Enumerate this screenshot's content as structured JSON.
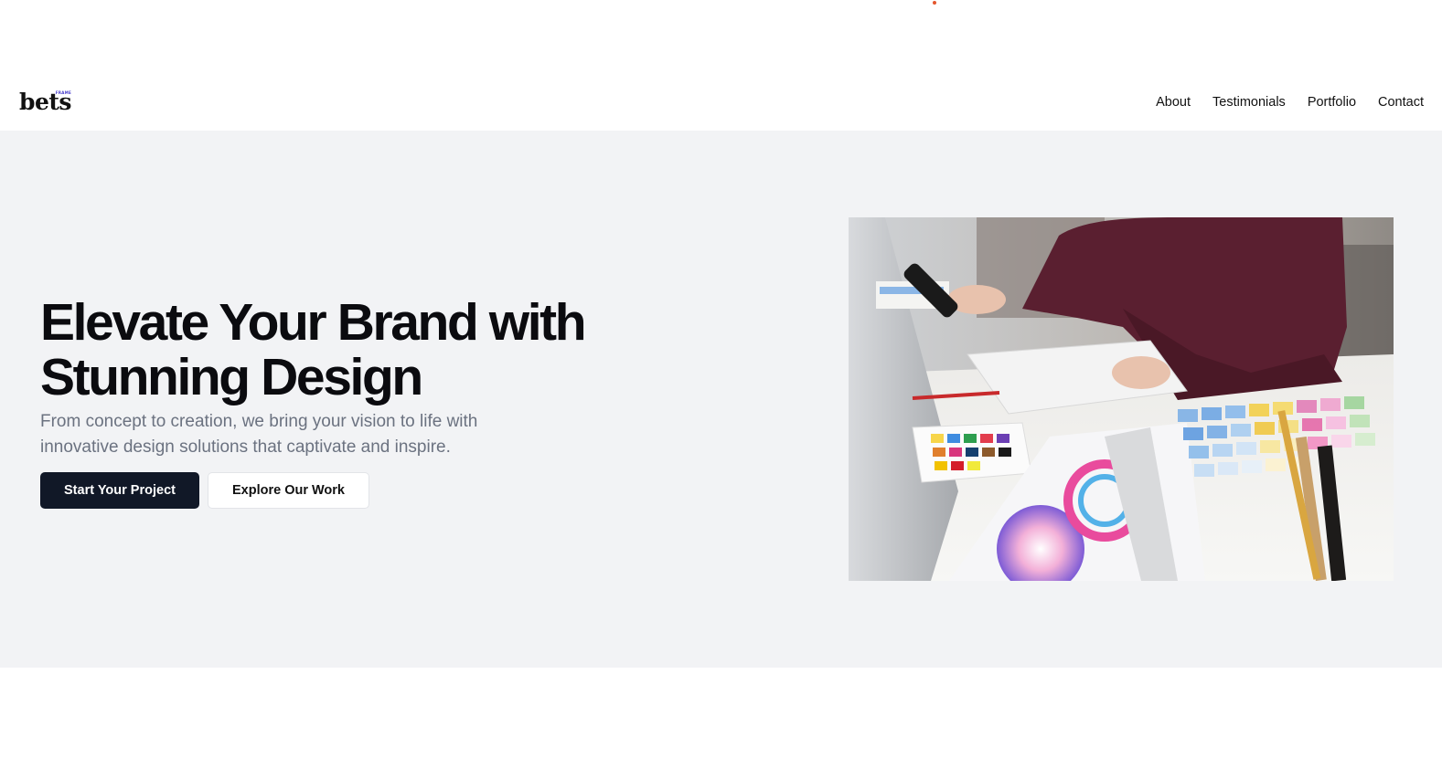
{
  "brand": {
    "logo_text": "bets",
    "logo_superscript": "FRAME"
  },
  "nav": {
    "items": [
      {
        "label": "About"
      },
      {
        "label": "Testimonials"
      },
      {
        "label": "Portfolio"
      },
      {
        "label": "Contact"
      }
    ]
  },
  "hero": {
    "title": "Elevate Your Brand with Stunning Design",
    "subtitle": "From concept to creation, we bring your vision to life with innovative design solutions that captivate and inspire.",
    "primary_cta": "Start Your Project",
    "secondary_cta": "Explore Our Work",
    "image_icon": "design-workspace-photo"
  },
  "colors": {
    "primary_button": "#111827",
    "hero_background": "#f2f3f5",
    "accent_dot": "#e4572e",
    "sweater": "#5a1f30"
  }
}
